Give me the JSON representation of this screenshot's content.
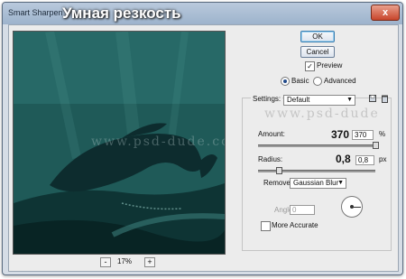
{
  "window": {
    "title": "Smart Sharpen",
    "overlay_title": "Умная резкость",
    "close": "x"
  },
  "preview": {
    "zoom_minus": "-",
    "zoom_value": "17%",
    "zoom_plus": "+",
    "watermark": "www.psd-dude.com"
  },
  "buttons": {
    "ok": "OK",
    "cancel": "Cancel"
  },
  "preview_checkbox": {
    "label": "Preview",
    "checked": true,
    "mark": "✓"
  },
  "mode": {
    "basic": "Basic",
    "advanced": "Advanced",
    "selected": "Basic"
  },
  "settings": {
    "label": "Settings:",
    "value": "Default"
  },
  "amount": {
    "label": "Amount:",
    "big_value": "370",
    "field_value": "370",
    "unit": "%"
  },
  "radius": {
    "label": "Radius:",
    "big_value": "0,8",
    "field_value": "0,8",
    "unit": "px"
  },
  "remove": {
    "label": "Remove:",
    "value": "Gaussian Blur"
  },
  "angle": {
    "label": "Angle:",
    "value": "0"
  },
  "more_accurate": {
    "label": "More Accurate",
    "checked": false
  },
  "watermark_right": "www.psd-dude",
  "colors": {
    "accent": "#3c7fb1",
    "preview_teal": "#1f5957"
  }
}
